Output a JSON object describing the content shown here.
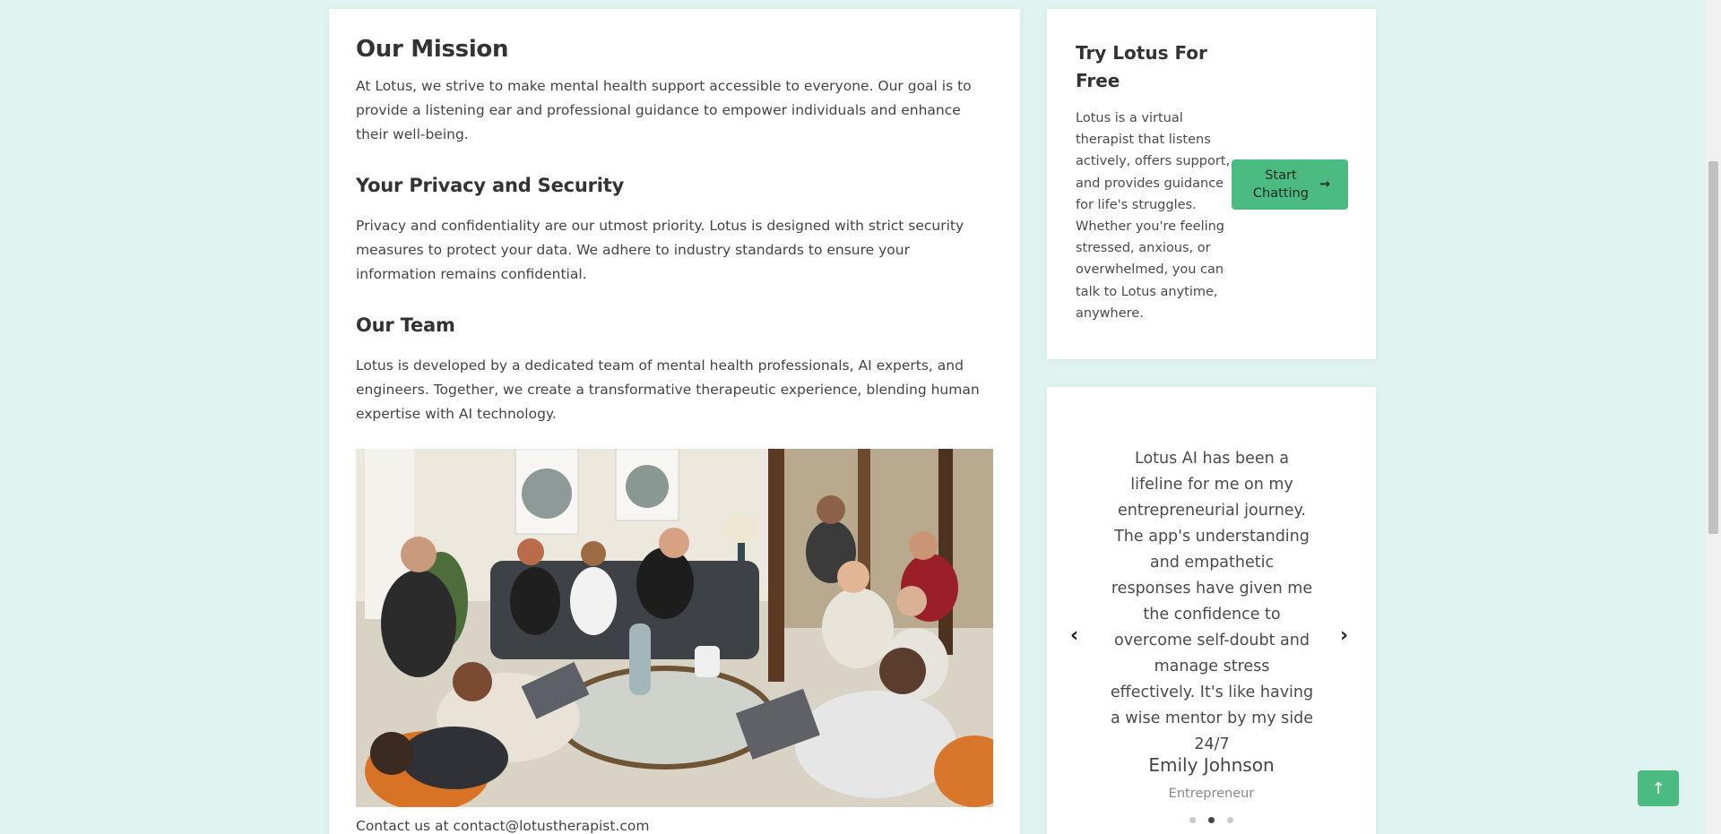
{
  "main": {
    "mission_title": "Our Mission",
    "mission_text": "At Lotus, we strive to make mental health support accessible to everyone. Our goal is to provide a listening ear and professional guidance to empower individuals and enhance their well-being.",
    "privacy_title": "Your Privacy and Security",
    "privacy_text": "Privacy and confidentiality are our utmost priority. Lotus is designed with strict security measures to protect your data. We adhere to industry standards to ensure your information remains confidential.",
    "team_title": "Our Team",
    "team_text": "Lotus is developed by a dedicated team of mental health professionals, AI experts, and engineers. Together, we create a transformative therapeutic experience, blending human expertise with AI technology.",
    "contact": "Contact us at contact@lotustherapist.com"
  },
  "try": {
    "title": "Try Lotus For Free",
    "text": "Lotus is a virtual therapist that listens actively, offers support, and provides guidance for life's struggles. Whether you're feeling stressed, anxious, or overwhelmed, you can talk to Lotus anytime, anywhere.",
    "button_label": "Start Chatting",
    "button_icon": "arrow-right-icon"
  },
  "testimonial": {
    "quote": "Lotus AI has been a lifeline for me on my entrepreneurial journey. The app's understanding and empathetic responses have given me the confidence to overcome self-doubt and manage stress effectively. It's like having a wise mentor by my side 24/7",
    "name": "Emily Johnson",
    "role": "Entrepreneur",
    "prev_icon": "chevron-left-icon",
    "next_icon": "chevron-right-icon",
    "slide_count": 3,
    "active_slide": 2
  },
  "scroll_top_icon": "arrow-up-icon",
  "colors": {
    "background": "#dff4f1",
    "accent": "#4cbb82",
    "card": "#ffffff"
  }
}
